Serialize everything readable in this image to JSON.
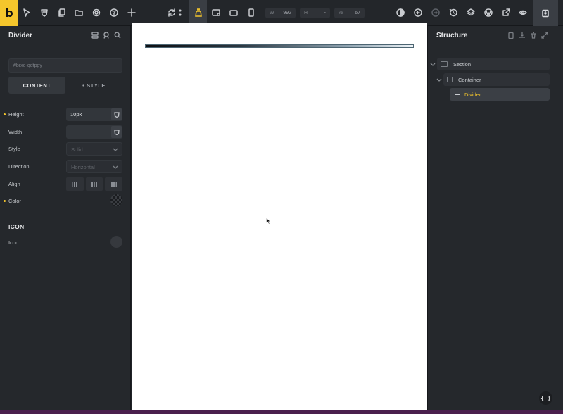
{
  "toolbar": {
    "logo": "b",
    "width_label": "W",
    "width_value": "992",
    "height_label": "H",
    "height_value": "-",
    "zoom_label": "%",
    "zoom_value": "67"
  },
  "left_panel": {
    "title": "Divider",
    "css_id": "#brxe-qdtpgy",
    "tabs": {
      "content": "CONTENT",
      "style": "STYLE"
    },
    "controls": {
      "height": {
        "label": "Height",
        "value": "10px"
      },
      "width": {
        "label": "Width",
        "value": ""
      },
      "style": {
        "label": "Style",
        "placeholder": "Solid"
      },
      "direction": {
        "label": "Direction",
        "placeholder": "Horizontal"
      },
      "align": {
        "label": "Align"
      },
      "color": {
        "label": "Color"
      }
    },
    "icon_section": {
      "heading": "ICON",
      "icon_label": "Icon"
    }
  },
  "right_panel": {
    "title": "Structure",
    "tree": [
      {
        "label": "Section"
      },
      {
        "label": "Container"
      },
      {
        "label": "Divider"
      }
    ],
    "code_button": "{ }"
  },
  "colors": {
    "accent": "#f5c62c",
    "panel_bg": "#25282c",
    "canvas_bg": "#ffffff"
  }
}
